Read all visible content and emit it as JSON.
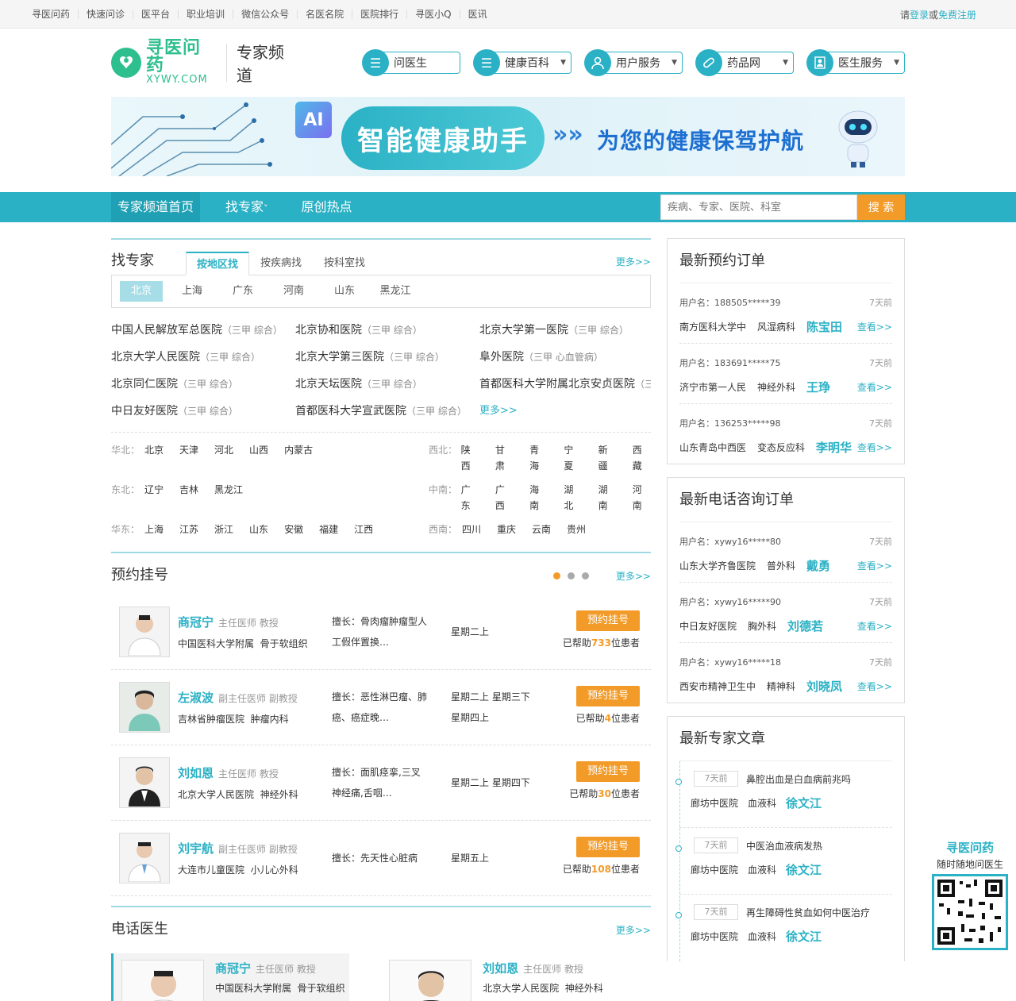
{
  "topnav": [
    "寻医问药",
    "快速问诊",
    "医平台",
    "职业培训",
    "微信公众号",
    "名医名院",
    "医院排行",
    "寻医小Q",
    "医讯"
  ],
  "login": {
    "prefix": "请",
    "login": "登录",
    "mid": "或",
    "register": "免费注册"
  },
  "logo": {
    "cn": "寻医问药",
    "en": "XYWY.COM"
  },
  "channel": "专家频道",
  "hnav": [
    {
      "label": "问医生",
      "icon": "list-icon",
      "arrow": ""
    },
    {
      "label": "健康百科",
      "icon": "list-icon",
      "arrow": "▼"
    },
    {
      "label": "用户服务",
      "icon": "user-icon",
      "arrow": "▼"
    },
    {
      "label": "药品网",
      "icon": "pill-icon",
      "arrow": "▼"
    },
    {
      "label": "医生服务",
      "icon": "doctor-icon",
      "arrow": "▼"
    }
  ],
  "banner": {
    "ai": "AI",
    "pill": "智能健康助手",
    "slogan": "为您的健康保驾护航"
  },
  "navbar": {
    "home": "专家频道首页",
    "find": "找专家",
    "find_arrow": "˅",
    "hot": "原创热点",
    "search_placeholder": "疾病、专家、医院、科室",
    "search_btn": "搜 索"
  },
  "find": {
    "title": "找专家",
    "tabs": [
      "按地区找",
      "按疾病找",
      "按科室找"
    ],
    "more": "更多>>",
    "cities": [
      "北京",
      "上海",
      "广东",
      "河南",
      "山东",
      "黑龙江"
    ],
    "hospitals": [
      {
        "name": "中国人民解放军总医院",
        "tag": "（三甲 综合）"
      },
      {
        "name": "北京协和医院",
        "tag": "（三甲 综合）"
      },
      {
        "name": "北京大学第一医院",
        "tag": "（三甲 综合）"
      },
      {
        "name": "北京大学人民医院",
        "tag": "（三甲 综合）"
      },
      {
        "name": "北京大学第三医院",
        "tag": "（三甲 综合）"
      },
      {
        "name": "阜外医院",
        "tag": "（三甲 心血管病）"
      },
      {
        "name": "北京同仁医院",
        "tag": "（三甲 综合）"
      },
      {
        "name": "北京天坛医院",
        "tag": "（三甲 综合）"
      },
      {
        "name": "首都医科大学附属北京安贞医院",
        "tag": "（三甲 综合）"
      },
      {
        "name": "中日友好医院",
        "tag": "（三甲 综合）"
      },
      {
        "name": "首都医科大学宣武医院",
        "tag": "（三甲 综合）"
      }
    ],
    "hosp_more": "更多>>",
    "regions": [
      {
        "name": "华北：",
        "cities": [
          "北京",
          "天津",
          "河北",
          "山西",
          "内蒙古"
        ]
      },
      {
        "name": "西北：",
        "cities": [
          "陕西",
          "甘肃",
          "青海",
          "宁夏",
          "新疆",
          "西藏"
        ]
      },
      {
        "name": "东北：",
        "cities": [
          "辽宁",
          "吉林",
          "黑龙江"
        ]
      },
      {
        "name": "中南：",
        "cities": [
          "广东",
          "广西",
          "海南",
          "湖北",
          "湖南",
          "河南"
        ]
      },
      {
        "name": "华东：",
        "cities": [
          "上海",
          "江苏",
          "浙江",
          "山东",
          "安徽",
          "福建",
          "江西"
        ]
      },
      {
        "name": "西南：",
        "cities": [
          "四川",
          "重庆",
          "云南",
          "贵州"
        ]
      }
    ]
  },
  "booking": {
    "title": "预约挂号",
    "more": "更多>>",
    "btn": "预约挂号",
    "doctors": [
      {
        "name": "商冠宁",
        "title": "主任医师 教授",
        "hospital": "中国医科大学附属",
        "dept": "骨于软组织",
        "good1": "擅长：骨肉瘤肿瘤型人",
        "good2": "工假伴置换…",
        "time1": "星期二上",
        "time2": "",
        "helped_pre": "已帮助",
        "helped": "733",
        "helped_post": "位患者"
      },
      {
        "name": "左淑波",
        "title": "副主任医师 副教授",
        "hospital": "吉林省肿瘤医院",
        "dept": "肿瘤内科",
        "good1": "擅长：恶性淋巴瘤、肺",
        "good2": "癌、癌症晚…",
        "time1": "星期二上 星期三下",
        "time2": "星期四上",
        "helped_pre": "已帮助",
        "helped": "4",
        "helped_post": "位患者"
      },
      {
        "name": "刘如恩",
        "title": "主任医师 教授",
        "hospital": "北京大学人民医院",
        "dept": "神经外科",
        "good1": "擅长：面肌痉挛,三叉",
        "good2": "神经痛,舌咽…",
        "time1": "星期二上 星期四下",
        "time2": "",
        "helped_pre": "已帮助",
        "helped": "30",
        "helped_post": "位患者"
      },
      {
        "name": "刘宇航",
        "title": "副主任医师 副教授",
        "hospital": "大连市儿童医院",
        "dept": "小儿心外科",
        "good1": "擅长：先天性心脏病",
        "good2": "",
        "time1": "星期五上",
        "time2": "",
        "helped_pre": "已帮助",
        "helped": "108",
        "helped_post": "位患者"
      }
    ]
  },
  "phone": {
    "title": "电话医生",
    "more": "更多>>",
    "doctors": [
      {
        "name": "商冠宁",
        "title": "主任医师 教授",
        "hospital": "中国医科大学附属",
        "dept": "骨于软组织"
      },
      {
        "name": "刘如恩",
        "title": "主任医师 教授",
        "hospital": "北京大学人民医院",
        "dept": "神经外科"
      }
    ]
  },
  "orders": {
    "title": "最新预约订单",
    "user_label": "用户名：",
    "view": "查看>>",
    "items": [
      {
        "user": "188505*****39",
        "ago": "7天前",
        "hospital": "南方医科大学中",
        "dept": "风湿病科",
        "doctor": "陈宝田"
      },
      {
        "user": "183691*****75",
        "ago": "7天前",
        "hospital": "济宁市第一人民",
        "dept": "神经外科",
        "doctor": "王琤"
      },
      {
        "user": "136253*****98",
        "ago": "7天前",
        "hospital": "山东青岛中西医",
        "dept": "变态反应科",
        "doctor": "李明华"
      }
    ]
  },
  "phone_orders": {
    "title": "最新电话咨询订单",
    "user_label": "用户名：",
    "view": "查看>>",
    "items": [
      {
        "user": "xywy16*****80",
        "ago": "7天前",
        "hospital": "山东大学齐鲁医院",
        "dept": "普外科",
        "doctor": "戴勇"
      },
      {
        "user": "xywy16*****90",
        "ago": "7天前",
        "hospital": "中日友好医院",
        "dept": "胸外科",
        "doctor": "刘德若"
      },
      {
        "user": "xywy16*****18",
        "ago": "7天前",
        "hospital": "西安市精神卫生中",
        "dept": "精神科",
        "doctor": "刘晓凤"
      }
    ]
  },
  "articles": {
    "title": "最新专家文章",
    "items": [
      {
        "ago": "7天前",
        "title": "鼻腔出血是白血病前兆吗",
        "hospital": "廊坊中医院",
        "dept": "血液科",
        "doctor": "徐文江"
      },
      {
        "ago": "7天前",
        "title": "中医治血液病发热",
        "hospital": "廊坊中医院",
        "dept": "血液科",
        "doctor": "徐文江"
      },
      {
        "ago": "7天前",
        "title": "再生障碍性贫血如何中医治疗",
        "hospital": "廊坊中医院",
        "dept": "血液科",
        "doctor": "徐文江"
      }
    ]
  },
  "qr": {
    "brand": "寻医问药",
    "slogan": "随时随地问医生"
  },
  "colors": {
    "accent": "#2bb1c5",
    "orange": "#f39b28",
    "logo_green": "#2ebf8e"
  }
}
